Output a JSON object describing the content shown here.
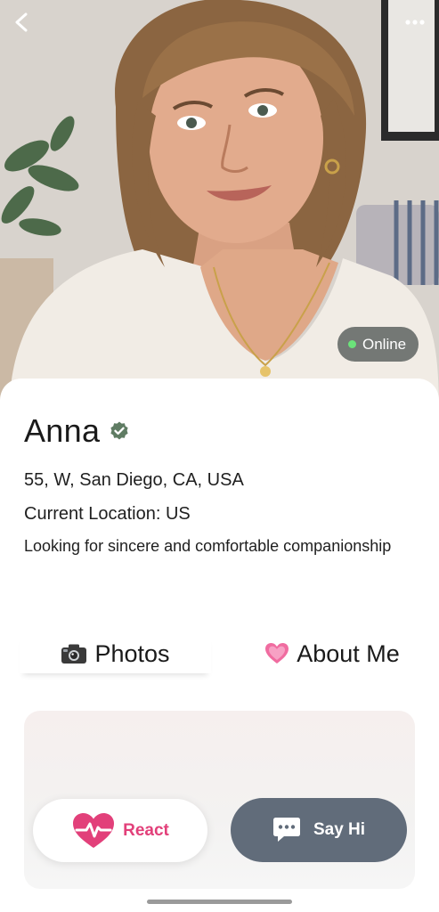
{
  "profile": {
    "name": "Anna",
    "status": "Online",
    "details": "55, W, San Diego, CA, USA",
    "current_location": "Current Location: US",
    "bio": "Looking for sincere and comfortable companionship"
  },
  "tabs": [
    {
      "label": "Photos",
      "icon": "camera-icon"
    },
    {
      "label": "About Me",
      "icon": "heart-icon"
    }
  ],
  "actions": {
    "react_label": "React",
    "react_icon": "heartbeat-icon",
    "sayhi_label": "Say Hi",
    "sayhi_icon": "chat-bubble-icon"
  },
  "colors": {
    "accent_pink": "#e2407a",
    "sayhi_button": "#616c7a",
    "online_dot": "#6be37a",
    "verified_badge": "#5f7c63"
  }
}
